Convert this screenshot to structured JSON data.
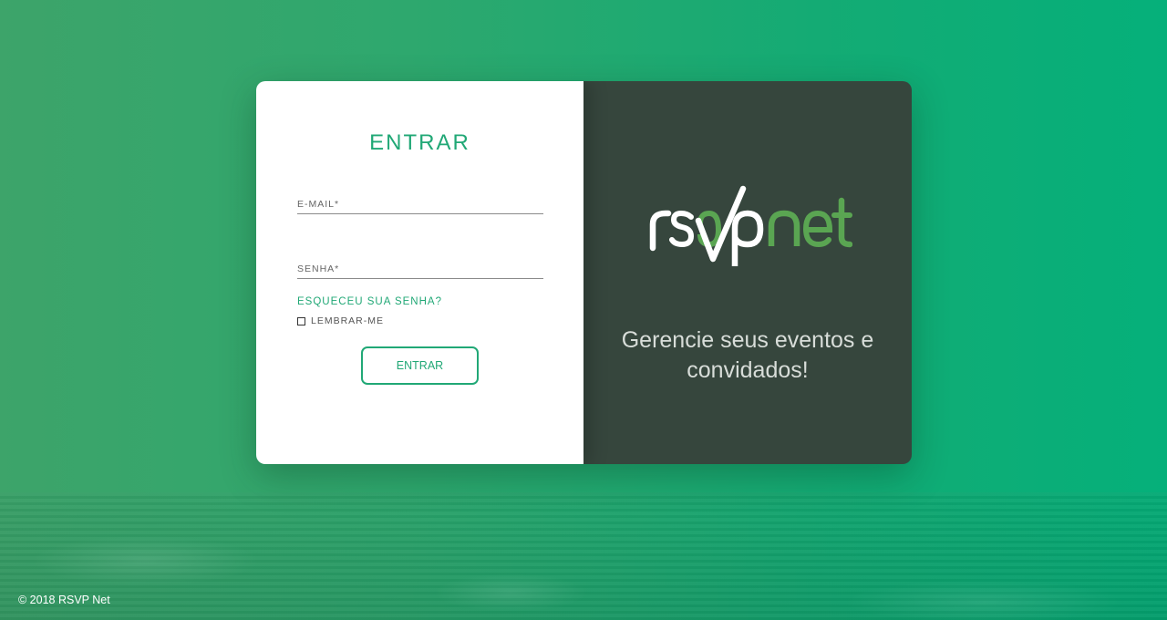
{
  "login": {
    "title": "ENTRAR",
    "email_label": "E-MAIL*",
    "email_value": "",
    "password_label": "SENHA*",
    "password_value": "",
    "forgot_link": "ESQUECEU SUA SENHA?",
    "remember_label": "LEMBRAR-ME",
    "remember_checked": false,
    "submit_label": "ENTRAR"
  },
  "brand": {
    "logo_text": "rsvpnet",
    "tagline": "Gerencie seus eventos e convidados!"
  },
  "footer": {
    "copyright": "© 2018 RSVP Net"
  },
  "colors": {
    "accent": "#21a876",
    "panel_dark": "#36463d",
    "logo_green": "#5aa552",
    "logo_white": "#ffffff"
  }
}
